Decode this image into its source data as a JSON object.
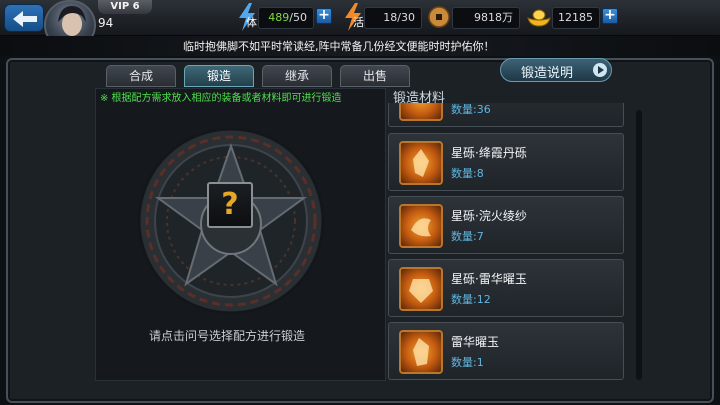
{
  "player": {
    "vip": "VIP 6",
    "level": "94"
  },
  "resources": {
    "stamina_icon_label": "体",
    "stamina_current": "489",
    "stamina_max": "/50",
    "energy_icon_label": "活",
    "energy_value": "18/30",
    "copper_value": "9818万",
    "gold_value": "12185",
    "plus_label": "+"
  },
  "notice": "临时抱佛脚不如平时常读经,阵中常备几份经文便能时时护佑你！",
  "tabs": [
    "合成",
    "锻造",
    "继承",
    "出售"
  ],
  "active_tab": "锻造",
  "forge_help_label": "锻造说明",
  "hint": "※ 根据配方需求放入相应的装备或者材料即可进行锻造",
  "slot_symbol": "?",
  "forge_prompt": "请点击问号选择配方进行锻造",
  "materials_title": "锻造材料",
  "materials": [
    {
      "name": "",
      "qty": "数量:36"
    },
    {
      "name": "星砾·绛霞丹砾",
      "qty": "数量:8"
    },
    {
      "name": "星砾·浣火绫纱",
      "qty": "数量:7"
    },
    {
      "name": "星砾·雷华曜玉",
      "qty": "数量:12"
    },
    {
      "name": "雷华曜玉",
      "qty": "数量:1"
    }
  ],
  "colors": {
    "accent_green": "#4ee04e",
    "qty_blue": "#5fb6e0",
    "slot_gold": "#e9a526"
  },
  "icons": {
    "back": "back-arrow-icon",
    "stamina": "lightning-icon",
    "copper": "coin-icon",
    "gold": "gold-ingot-icon",
    "help_arrow": "play-arrow-icon"
  }
}
